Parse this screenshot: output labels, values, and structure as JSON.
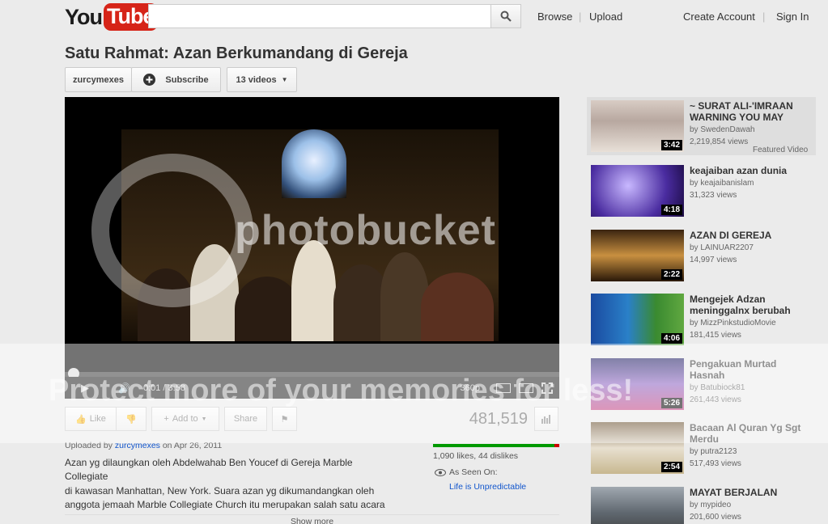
{
  "header": {
    "logo_you": "You",
    "logo_tube": "Tube",
    "search_placeholder": "",
    "browse": "Browse",
    "upload": "Upload",
    "create_account": "Create Account",
    "sign_in": "Sign In"
  },
  "video": {
    "title": "Satu Rahmat: Azan Berkumandang di Gereja",
    "channel": "zurcymexes",
    "subscribe": "Subscribe",
    "videos_count": "13 videos",
    "time": "0:01 / 3:58",
    "quality": "360p",
    "like": "Like",
    "add_to": "Add to",
    "share": "Share",
    "views": "481,519",
    "uploaded_prefix": "Uploaded by",
    "uploaded_by": "zurcymexes",
    "uploaded_date": "on Apr 26, 2011",
    "desc_line1": "Azan yg dilaungkan oleh Abdelwahab Ben Youcef di Gereja Marble",
    "desc_line2": "Collegiate",
    "desc_line3": "di kawasan Manhattan, New York. Suara azan yg dikumandangkan oleh",
    "desc_line4": "anggota jemaah Marble Collegiate Church itu merupakan salah satu acara",
    "likes_dislikes": "1,090 likes, 44 dislikes",
    "like_ratio": 0.961,
    "as_seen_on": "As Seen On:",
    "as_seen_link": "Life is Unpredictable",
    "show_more": "Show more"
  },
  "watermark": {
    "line1": "photobucket",
    "line2": "Protect more of your memories for less!"
  },
  "related": [
    {
      "title": "~ SURAT ALI-'IMRAAN WARNING YOU MAY",
      "by": "by SwedenDawah",
      "views": "2,219,854 views",
      "duration": "3:42",
      "featured": "Featured Video"
    },
    {
      "title": "keajaiban azan dunia",
      "by": "by keajaibanislam",
      "views": "31,323 views",
      "duration": "4:18"
    },
    {
      "title": "AZAN DI GEREJA",
      "by": "by LAINUAR2207",
      "views": "14,997 views",
      "duration": "2:22"
    },
    {
      "title": "Mengejek Adzan meninggalnx berubah",
      "by": "by MizzPinkstudioMovie",
      "views": "181,415 views",
      "duration": "4:06"
    },
    {
      "title": "Pengakuan Murtad Hasnah",
      "by": "by Batubiock81",
      "views": "261,443 views",
      "duration": "5:26"
    },
    {
      "title": "Bacaan Al Quran Yg Sgt Merdu",
      "by": "by putra2123",
      "views": "517,493 views",
      "duration": "2:54"
    },
    {
      "title": "MAYAT BERJALAN",
      "by": "by mypideo",
      "views": "201,600 views",
      "duration": ""
    }
  ]
}
